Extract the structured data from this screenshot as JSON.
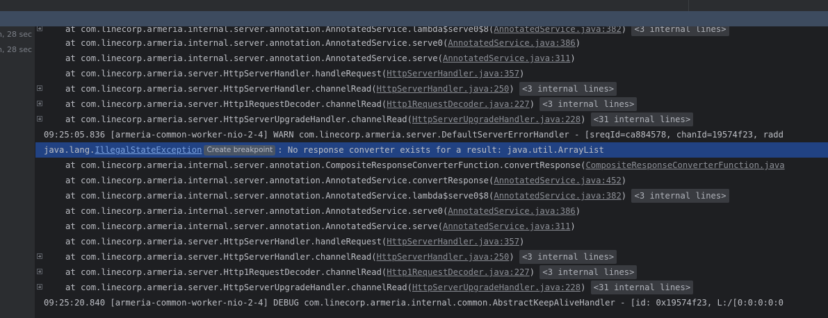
{
  "timestamps": [
    {
      "text": "n, 28 sec"
    },
    {
      "text": "n, 28 sec"
    }
  ],
  "console": {
    "lines": [
      {
        "at": "at ",
        "pre": "com.linecorp.armeria.internal.server.annotation.AnnotatedService.lambda$serve0$8(",
        "link": "AnnotatedService.java:382",
        "post": ")",
        "chip": "<3 internal lines>",
        "fold": true
      },
      {
        "at": "at ",
        "pre": "com.linecorp.armeria.internal.server.annotation.AnnotatedService.serve0(",
        "link": "AnnotatedService.java:386",
        "post": ")",
        "chip": "",
        "fold": false
      },
      {
        "at": "at ",
        "pre": "com.linecorp.armeria.internal.server.annotation.AnnotatedService.serve(",
        "link": "AnnotatedService.java:311",
        "post": ")",
        "chip": "",
        "fold": false
      },
      {
        "at": "at ",
        "pre": "com.linecorp.armeria.server.HttpServerHandler.handleRequest(",
        "link": "HttpServerHandler.java:357",
        "post": ")",
        "chip": "",
        "fold": false
      },
      {
        "at": "at ",
        "pre": "com.linecorp.armeria.server.HttpServerHandler.channelRead(",
        "link": "HttpServerHandler.java:250",
        "post": ")",
        "chip": "<3 internal lines>",
        "fold": true
      },
      {
        "at": "at ",
        "pre": "com.linecorp.armeria.server.Http1RequestDecoder.channelRead(",
        "link": "Http1RequestDecoder.java:227",
        "post": ")",
        "chip": "<3 internal lines>",
        "fold": true
      },
      {
        "at": "at ",
        "pre": "com.linecorp.armeria.server.HttpServerUpgradeHandler.channelRead(",
        "link": "HttpServerUpgradeHandler.java:228",
        "post": ")",
        "chip": "<31 internal lines>",
        "fold": true
      },
      {
        "at": "",
        "pre": "09:25:05.836 [armeria-common-worker-nio-2-4] WARN com.linecorp.armeria.server.DefaultServerErrorHandler - [sreqId=ca884578, chanId=19574f23, radd",
        "link": "",
        "post": "",
        "chip": "",
        "fold": false
      },
      {
        "exception": true
      },
      {
        "at": "at ",
        "pre": "com.linecorp.armeria.internal.server.annotation.CompositeResponseConverterFunction.convertResponse(",
        "link": "CompositeResponseConverterFunction.java",
        "post": "",
        "chip": "",
        "fold": false
      },
      {
        "at": "at ",
        "pre": "com.linecorp.armeria.internal.server.annotation.AnnotatedService.convertResponse(",
        "link": "AnnotatedService.java:452",
        "post": ")",
        "chip": "",
        "fold": false
      },
      {
        "at": "at ",
        "pre": "com.linecorp.armeria.internal.server.annotation.AnnotatedService.lambda$serve0$8(",
        "link": "AnnotatedService.java:382",
        "post": ")",
        "chip": "<3 internal lines>",
        "fold": true
      },
      {
        "at": "at ",
        "pre": "com.linecorp.armeria.internal.server.annotation.AnnotatedService.serve0(",
        "link": "AnnotatedService.java:386",
        "post": ")",
        "chip": "",
        "fold": false
      },
      {
        "at": "at ",
        "pre": "com.linecorp.armeria.internal.server.annotation.AnnotatedService.serve(",
        "link": "AnnotatedService.java:311",
        "post": ")",
        "chip": "",
        "fold": false
      },
      {
        "at": "at ",
        "pre": "com.linecorp.armeria.server.HttpServerHandler.handleRequest(",
        "link": "HttpServerHandler.java:357",
        "post": ")",
        "chip": "",
        "fold": false
      },
      {
        "at": "at ",
        "pre": "com.linecorp.armeria.server.HttpServerHandler.channelRead(",
        "link": "HttpServerHandler.java:250",
        "post": ")",
        "chip": "<3 internal lines>",
        "fold": true
      },
      {
        "at": "at ",
        "pre": "com.linecorp.armeria.server.Http1RequestDecoder.channelRead(",
        "link": "Http1RequestDecoder.java:227",
        "post": ")",
        "chip": "<3 internal lines>",
        "fold": true
      },
      {
        "at": "at ",
        "pre": "com.linecorp.armeria.server.HttpServerUpgradeHandler.channelRead(",
        "link": "HttpServerUpgradeHandler.java:228",
        "post": ")",
        "chip": "<31 internal lines>",
        "fold": true
      },
      {
        "at": "",
        "pre": "09:25:20.840 [armeria-common-worker-nio-2-4] DEBUG com.linecorp.armeria.internal.common.AbstractKeepAliveHandler - [id: 0x19574f23, L:/[0:0:0:0:0",
        "link": "",
        "post": "",
        "chip": "",
        "fold": false
      }
    ],
    "exception_line": {
      "prefix": "java.lang.",
      "class_name": "IllegalStateException",
      "breakpoint_label": "Create breakpoint",
      "message": ": No response converter exists for a result: java.util.ArrayList"
    }
  },
  "colors": {
    "console_bg": "#1e1f22",
    "panel_bg": "#2b2d30",
    "header_bar": "#3d4b5f",
    "selection": "#214283",
    "text": "#bcbec4",
    "link": "#8c8f96"
  }
}
